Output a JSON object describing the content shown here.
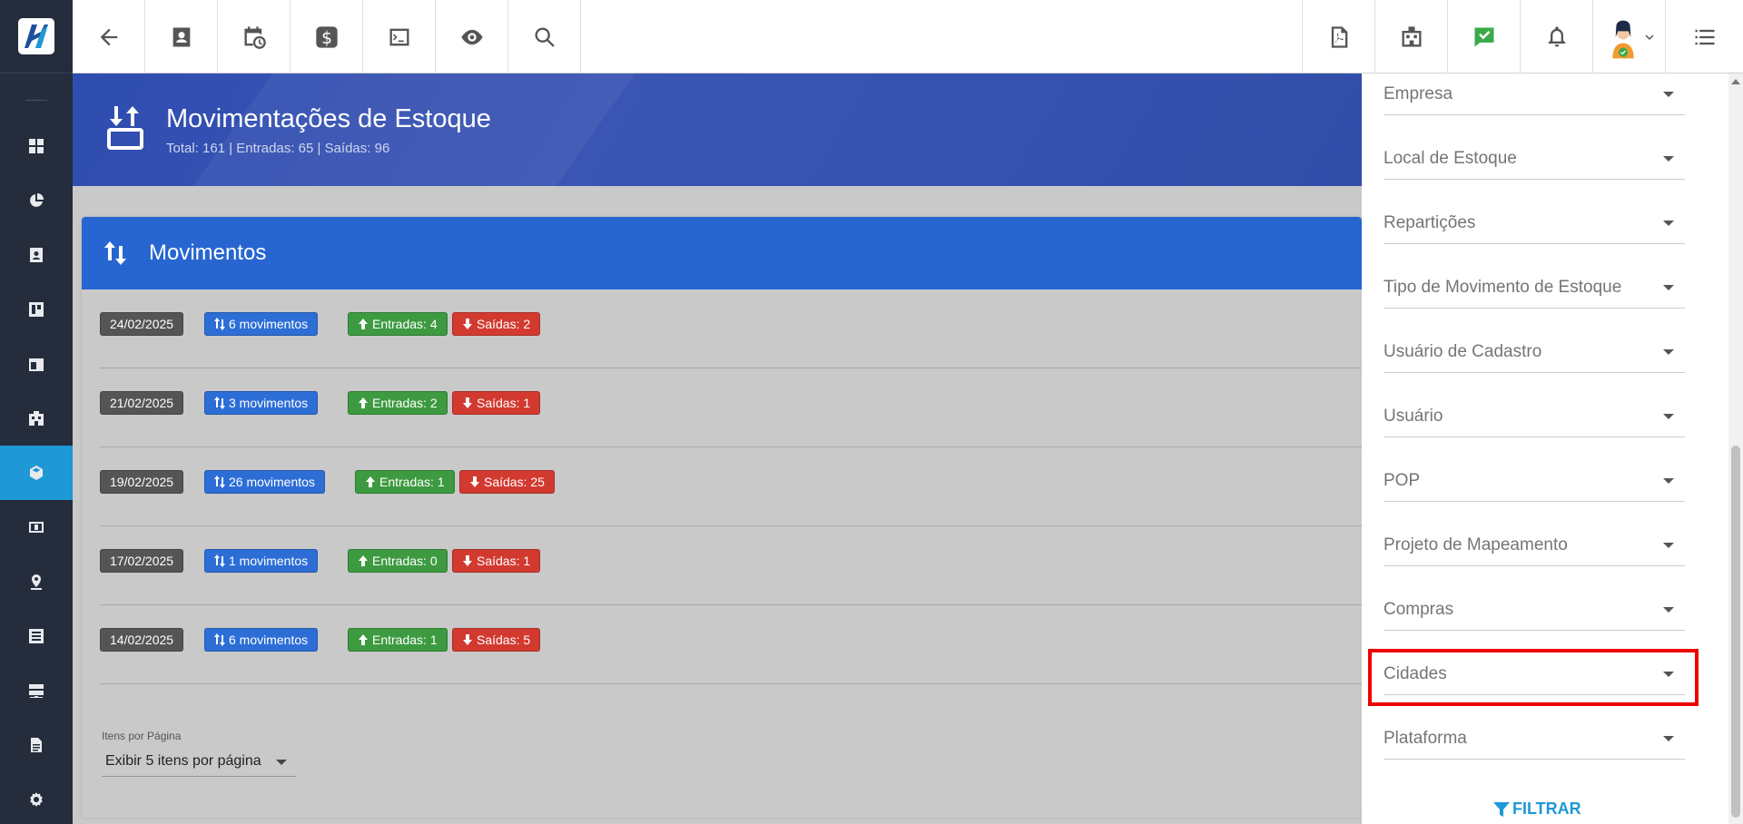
{
  "topbar": {
    "left_icons": [
      "back-arrow-icon",
      "contact-card-icon",
      "calendar-clock-icon",
      "dollar-icon",
      "terminal-icon",
      "eye-icon",
      "search-icon"
    ],
    "right_icons": [
      "pdf-icon",
      "building-icon",
      "task-check-icon",
      "bell-icon",
      "avatar",
      "list-menu-icon"
    ]
  },
  "sidebar": {
    "items": [
      "dashboard-icon",
      "pie-chart-icon",
      "contact-icon",
      "board-icon",
      "calendar-icon",
      "building-icon",
      "box-icon",
      "money-icon",
      "map-pin-icon",
      "list-icon",
      "server-icon",
      "document-icon",
      "gear-icon"
    ],
    "active_index": 6
  },
  "header": {
    "title": "Movimentações de Estoque",
    "subtitle": "Total: 161 | Entradas: 65 | Saídas: 96"
  },
  "card": {
    "title": "Movimentos",
    "rows": [
      {
        "date": "24/02/2025",
        "movements": "6 movimentos",
        "entradas": "Entradas: 4",
        "saidas": "Saídas: 2"
      },
      {
        "date": "21/02/2025",
        "movements": "3 movimentos",
        "entradas": "Entradas: 2",
        "saidas": "Saídas: 1"
      },
      {
        "date": "19/02/2025",
        "movements": "26 movimentos",
        "entradas": "Entradas: 1",
        "saidas": "Saídas: 25"
      },
      {
        "date": "17/02/2025",
        "movements": "1 movimentos",
        "entradas": "Entradas: 0",
        "saidas": "Saídas: 1"
      },
      {
        "date": "14/02/2025",
        "movements": "6 movimentos",
        "entradas": "Entradas: 1",
        "saidas": "Saídas: 5"
      }
    ],
    "items_per_page_label": "Itens por Página",
    "items_per_page_value": "Exibir 5 itens por página"
  },
  "filter": {
    "fields": [
      "Empresa",
      "Local de Estoque",
      "Repartições",
      "Tipo de Movimento de Estoque",
      "Usuário de Cadastro",
      "Usuário",
      "POP",
      "Projeto de Mapeamento",
      "Compras",
      "Cidades",
      "Plataforma"
    ],
    "button_label": "FILTRAR"
  },
  "colors": {
    "sidebar_bg": "#252c3c",
    "sidebar_active": "#1f98d6",
    "banner": "#3350b0",
    "card_header": "#2766d1",
    "entradas": "#3d9a40",
    "saidas": "#d23a30",
    "highlight": "#ee0000"
  }
}
